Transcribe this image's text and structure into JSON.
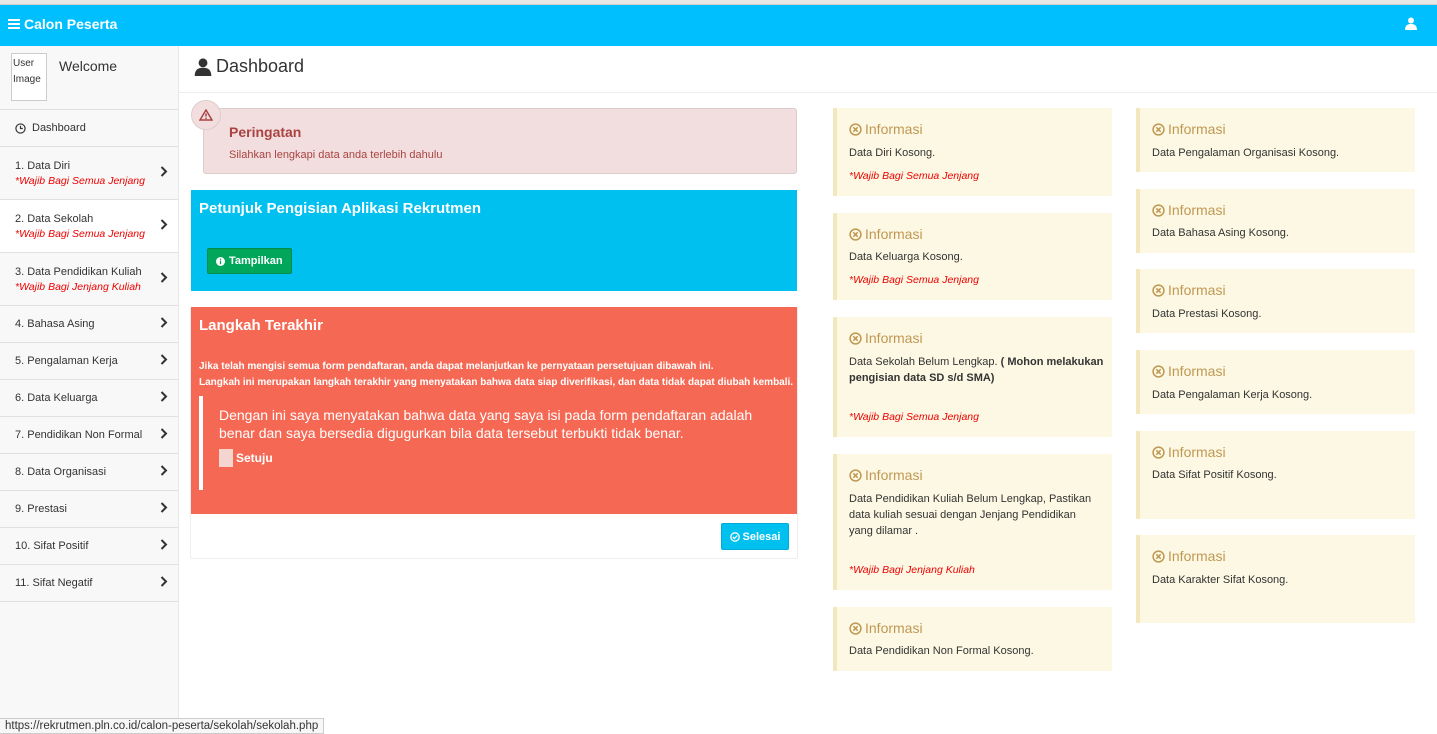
{
  "navbar": {
    "brand": "Calon Peserta"
  },
  "sidebar": {
    "user_image": "User Image",
    "welcome": "Welcome",
    "dashboard": "Dashboard",
    "items": [
      {
        "label": "1. Data Diri",
        "req": "*Wajib Bagi Semua Jenjang"
      },
      {
        "label": "2. Data Sekolah",
        "req": "*Wajib Bagi Semua Jenjang"
      },
      {
        "label": "3. Data Pendidikan Kuliah",
        "req": "*Wajib Bagi Jenjang Kuliah"
      },
      {
        "label": "4. Bahasa Asing"
      },
      {
        "label": "5. Pengalaman Kerja"
      },
      {
        "label": "6. Data Keluarga"
      },
      {
        "label": "7. Pendidikan Non Formal"
      },
      {
        "label": "8. Data Organisasi"
      },
      {
        "label": "9. Prestasi"
      },
      {
        "label": "10. Sifat Positif"
      },
      {
        "label": "11. Sifat Negatif"
      }
    ]
  },
  "header": {
    "title": "Dashboard"
  },
  "warning": {
    "title": "Peringatan",
    "text": "Silahkan lengkapi data anda terlebih dahulu"
  },
  "petunjuk": {
    "title": "Petunjuk Pengisian Aplikasi Rekrutmen",
    "button": "Tampilkan"
  },
  "langkah": {
    "title": "Langkah Terakhir",
    "line1": "Jika telah mengisi semua form pendaftaran, anda dapat melanjutkan ke pernyataan persetujuan dibawah ini.",
    "line2": "Langkah ini merupakan langkah terakhir yang menyatakan bahwa data siap diverifikasi, dan data tidak dapat diubah kembali.",
    "quote": "Dengan ini saya menyatakan bahwa data yang saya isi pada form pendaftaran adalah benar dan saya bersedia digugurkan bila data tersebut terbukti tidak benar.",
    "agree": "Setuju",
    "finish": "Selesai"
  },
  "info_title": "Informasi",
  "info_left": [
    {
      "body": "Data Diri Kosong.",
      "req": "*Wajib Bagi Semua Jenjang"
    },
    {
      "body": "Data Keluarga Kosong.",
      "req": "*Wajib Bagi Semua Jenjang"
    },
    {
      "body_pre": "Data Sekolah Belum Lengkap. ",
      "body_bold": "( Mohon melakukan pengisian data SD s/d SMA)",
      "req": "*Wajib Bagi Semua Jenjang"
    },
    {
      "body": "Data Pendidikan Kuliah Belum Lengkap, Pastikan data kuliah sesuai dengan Jenjang Pendidikan yang dilamar .",
      "req": "*Wajib Bagi Jenjang Kuliah"
    },
    {
      "body": "Data Pendidikan Non Formal Kosong."
    }
  ],
  "info_right": [
    {
      "body": "Data Pengalaman Organisasi Kosong."
    },
    {
      "body": "Data Bahasa Asing Kosong."
    },
    {
      "body": "Data Prestasi Kosong."
    },
    {
      "body": "Data Pengalaman Kerja Kosong."
    },
    {
      "body": "Data Sifat Positif Kosong."
    },
    {
      "body": "Data Karakter Sifat Kosong."
    }
  ],
  "status_url": "https://rekrutmen.pln.co.id/calon-peserta/sekolah/sekolah.php",
  "colors": {
    "navbar": "#00bfff",
    "success": "#00a65a",
    "danger": "#f56954",
    "info": "#00c0ef",
    "warning_bg": "#fcf8e3"
  }
}
